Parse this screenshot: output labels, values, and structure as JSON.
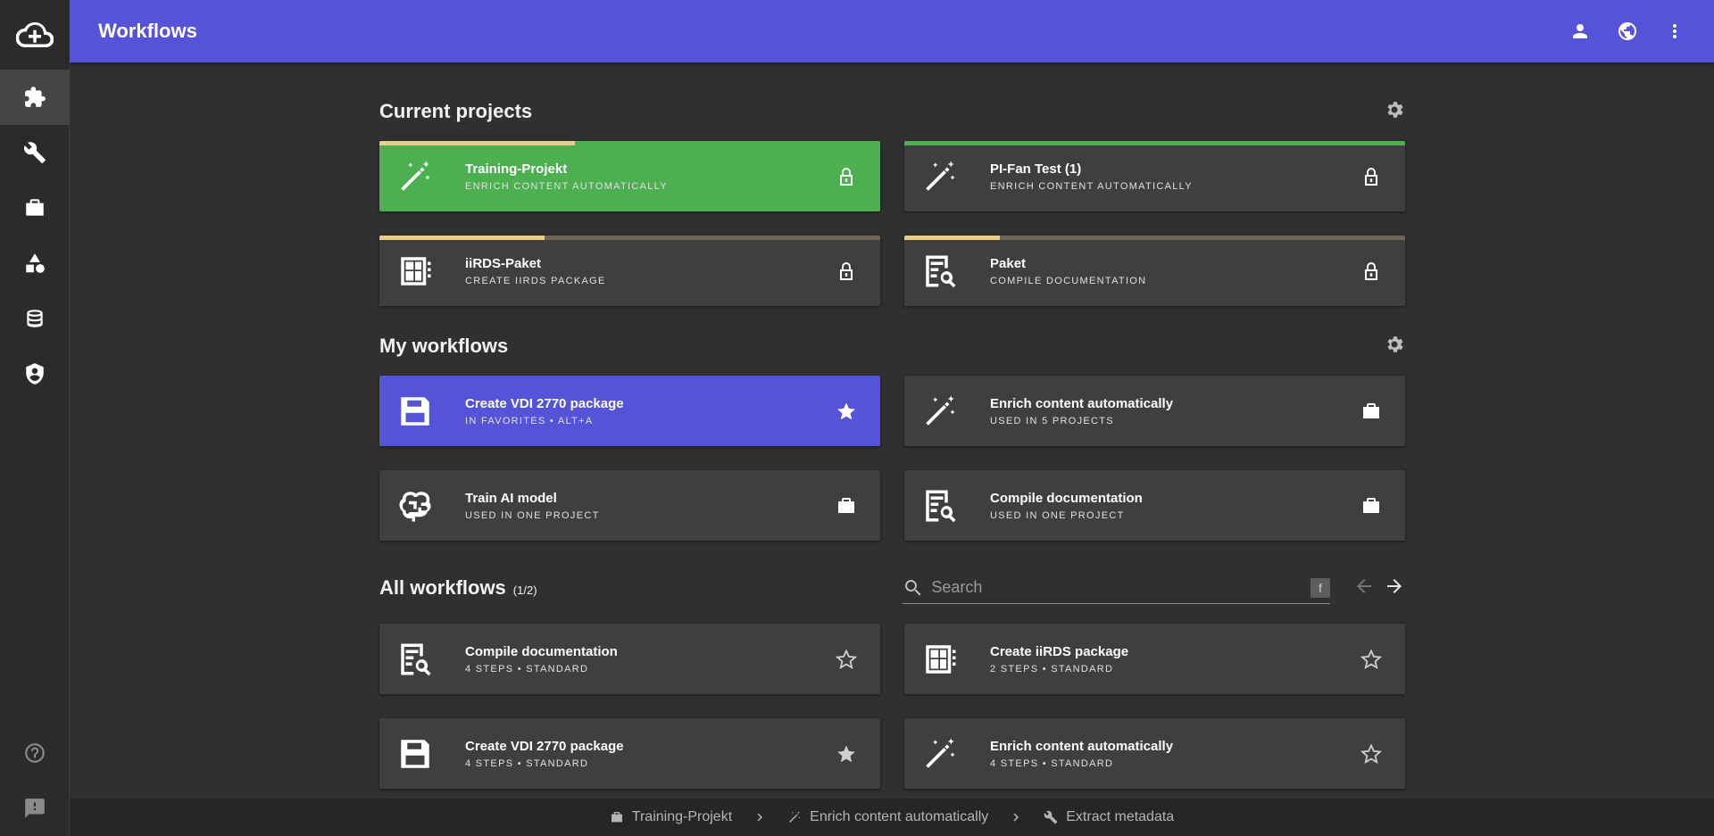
{
  "header": {
    "title": "Workflows"
  },
  "sidebar": {
    "items": [
      {
        "name": "puzzle-icon",
        "active": true
      },
      {
        "name": "wrench-icon",
        "active": false
      },
      {
        "name": "briefcase-icon",
        "active": false
      },
      {
        "name": "shapes-icon",
        "active": false
      },
      {
        "name": "database-icon",
        "active": false
      },
      {
        "name": "shield-user-icon",
        "active": false
      }
    ],
    "bottom": [
      "help-icon",
      "feedback-icon"
    ]
  },
  "current_projects": {
    "title": "Current projects",
    "cards": [
      {
        "name": "Training-Projekt",
        "sub": "ENRICH CONTENT AUTOMATICALLY",
        "icon": "magic-wand-icon",
        "action": "lock-icon",
        "progress": 0.39,
        "style": "green"
      },
      {
        "name": "PI-Fan Test (1)",
        "sub": "ENRICH CONTENT AUTOMATICALLY",
        "icon": "magic-wand-icon",
        "action": "lock-icon",
        "progress": 1.0,
        "style": "default"
      },
      {
        "name": "iiRDS-Paket",
        "sub": "CREATE IIRDS PACKAGE",
        "icon": "package-grid-icon",
        "action": "lock-icon",
        "progress": 0.33,
        "style": "default"
      },
      {
        "name": "Paket",
        "sub": "COMPILE DOCUMENTATION",
        "icon": "document-search-icon",
        "action": "lock-icon",
        "progress": 0.19,
        "style": "default"
      }
    ]
  },
  "my_workflows": {
    "title": "My workflows",
    "cards": [
      {
        "name": "Create VDI 2770 package",
        "sub": "IN FAVORITES • ALT+A",
        "icon": "floppy-icon",
        "action": "star-filled-icon",
        "style": "purple"
      },
      {
        "name": "Enrich content automatically",
        "sub": "USED IN 5 PROJECTS",
        "icon": "magic-wand-icon",
        "action": "briefcase-icon",
        "style": "default"
      },
      {
        "name": "Train AI model",
        "sub": "USED IN ONE PROJECT",
        "icon": "brain-icon",
        "action": "briefcase-icon",
        "style": "default"
      },
      {
        "name": "Compile documentation",
        "sub": "USED IN ONE PROJECT",
        "icon": "document-search-icon",
        "action": "briefcase-icon",
        "style": "default"
      }
    ]
  },
  "all_workflows": {
    "title": "All workflows",
    "count": "(1/2)",
    "search": {
      "placeholder": "Search",
      "shortcut": "f"
    },
    "cards": [
      {
        "name": "Compile documentation",
        "sub": "4 STEPS • STANDARD",
        "icon": "document-search-icon",
        "action": "star-outline-icon"
      },
      {
        "name": "Create iiRDS package",
        "sub": "2 STEPS • STANDARD",
        "icon": "package-grid-icon",
        "action": "star-outline-icon"
      },
      {
        "name": "Create VDI 2770 package",
        "sub": "4 STEPS • STANDARD",
        "icon": "floppy-icon",
        "action": "star-filled-grey-icon"
      },
      {
        "name": "Enrich content automatically",
        "sub": "4 STEPS • STANDARD",
        "icon": "magic-wand-icon",
        "action": "star-outline-icon"
      }
    ]
  },
  "footer": {
    "crumbs": [
      {
        "label": "Training-Projekt",
        "icon": "briefcase-icon"
      },
      {
        "label": "Enrich content automatically",
        "icon": "magic-wand-icon"
      },
      {
        "label": "Extract metadata",
        "icon": "wrench-icon"
      }
    ]
  },
  "colors": {
    "header": "#5553d8",
    "active_project": "#4caf50",
    "progress": "#e8cc8a",
    "background": "#303030",
    "card": "#3f3f3f"
  }
}
